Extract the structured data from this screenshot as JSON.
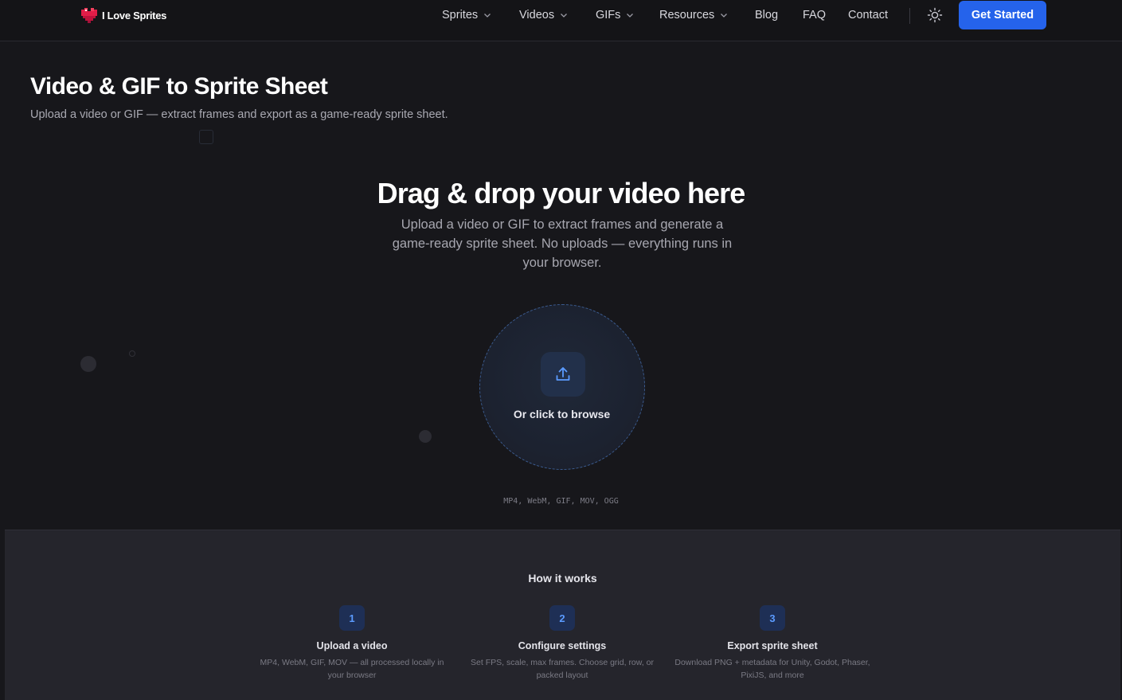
{
  "brand": {
    "name": "I Love Sprites"
  },
  "nav": {
    "items": [
      {
        "label": "Sprites",
        "dropdown": true
      },
      {
        "label": "Videos",
        "dropdown": true
      },
      {
        "label": "GIFs",
        "dropdown": true
      },
      {
        "label": "Resources",
        "dropdown": true
      },
      {
        "label": "Blog",
        "dropdown": false
      },
      {
        "label": "FAQ",
        "dropdown": false
      },
      {
        "label": "Contact",
        "dropdown": false
      }
    ],
    "theme_icon": "sun-icon",
    "cta_label": "Get Started"
  },
  "page": {
    "title": "Video & GIF to Sprite Sheet",
    "subtitle": "Upload a video or GIF — extract frames and export as a game-ready sprite sheet."
  },
  "dropzone": {
    "title": "Drag & drop your video here",
    "description": "Upload a video or GIF to extract frames and generate a game-ready sprite sheet. No uploads — everything runs in your browser.",
    "browse_label": "Or click to browse",
    "formats": "MP4, WebM, GIF, MOV, OGG",
    "icon": "upload-icon"
  },
  "how_it_works": {
    "title": "How it works",
    "steps": [
      {
        "number": "1",
        "title": "Upload a video",
        "desc": "MP4, WebM, GIF, MOV — all processed locally in your browser"
      },
      {
        "number": "2",
        "title": "Configure settings",
        "desc": "Set FPS, scale, max frames. Choose grid, row, or packed layout"
      },
      {
        "number": "3",
        "title": "Export sprite sheet",
        "desc": "Download PNG + metadata for Unity, Godot, Phaser, PixiJS, and more"
      }
    ]
  },
  "colors": {
    "background": "#17171b",
    "accent": "#2563eb",
    "step_number": "#5b9bff"
  }
}
